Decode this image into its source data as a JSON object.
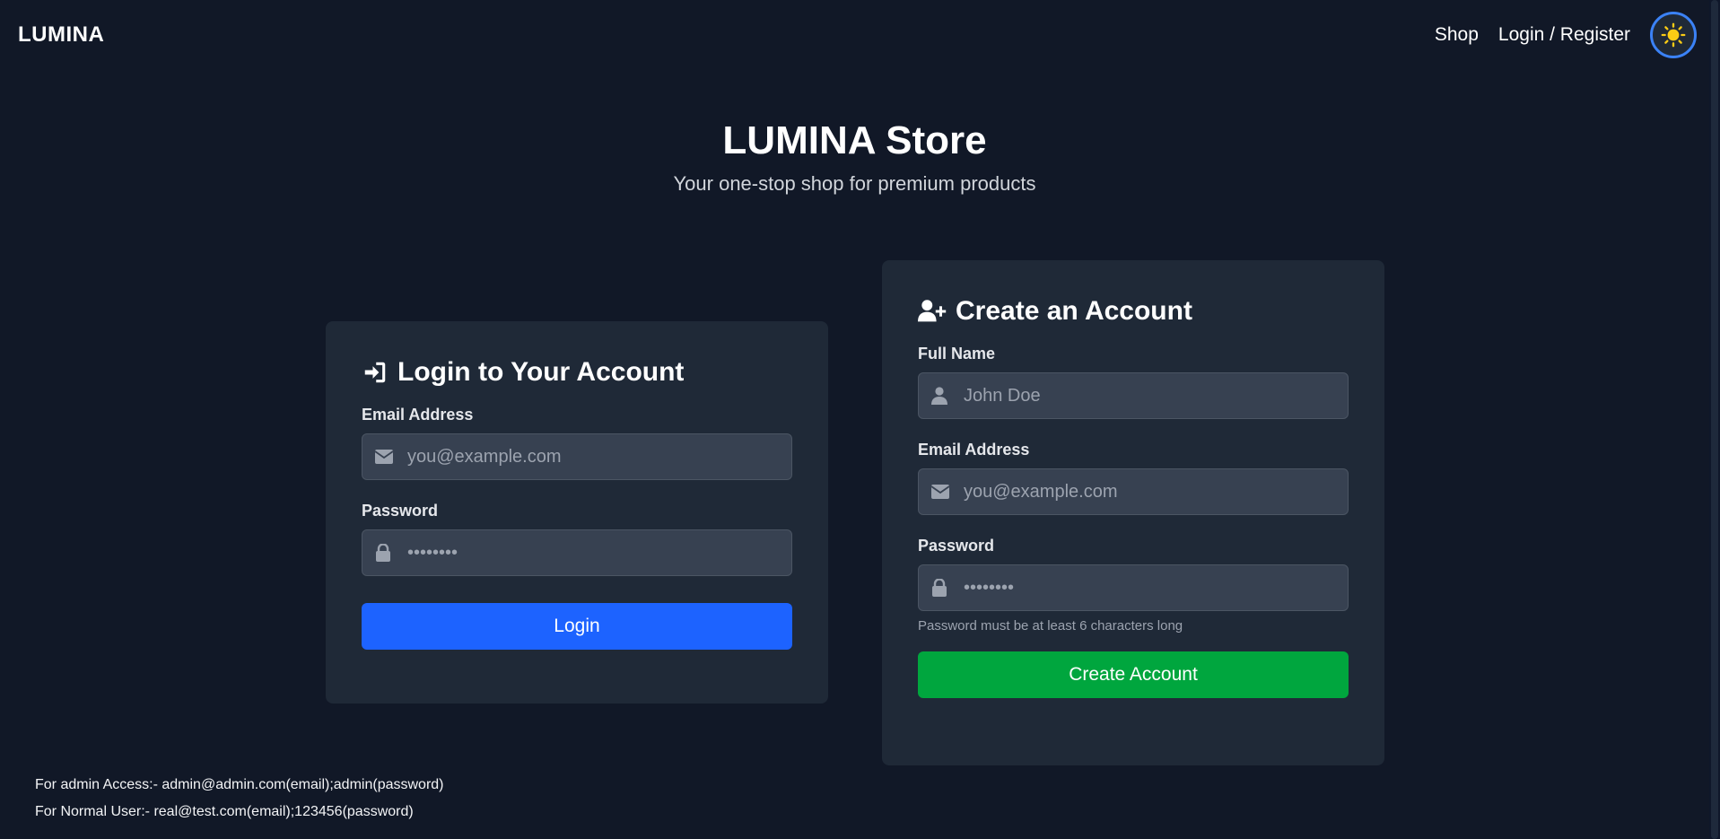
{
  "navbar": {
    "brand": "LUMINA",
    "links": [
      {
        "label": "Shop"
      },
      {
        "label": "Login / Register"
      }
    ],
    "theme_icon": "sun-icon"
  },
  "hero": {
    "title": "LUMINA Store",
    "subtitle": "Your one-stop shop for premium products"
  },
  "login": {
    "title": "Login to Your Account",
    "title_icon": "sign-in-icon",
    "email_label": "Email Address",
    "email_placeholder": "you@example.com",
    "password_label": "Password",
    "password_placeholder": "••••••••",
    "button_label": "Login"
  },
  "register": {
    "title": "Create an Account",
    "title_icon": "user-plus-icon",
    "name_label": "Full Name",
    "name_placeholder": "John Doe",
    "email_label": "Email Address",
    "email_placeholder": "you@example.com",
    "password_label": "Password",
    "password_placeholder": "••••••••",
    "password_hint": "Password must be at least 6 characters long",
    "button_label": "Create Account"
  },
  "notes": {
    "admin": "For admin Access:- admin@admin.com(email);admin(password)",
    "user": "For Normal User:- real@test.com(email);123456(password)"
  },
  "colors": {
    "background": "#111827",
    "card": "#1f2937",
    "input": "#374151",
    "primary": "#1d63ff",
    "success": "#00a63e",
    "toggle_border": "#3b82f6",
    "sun": "#facc15"
  }
}
